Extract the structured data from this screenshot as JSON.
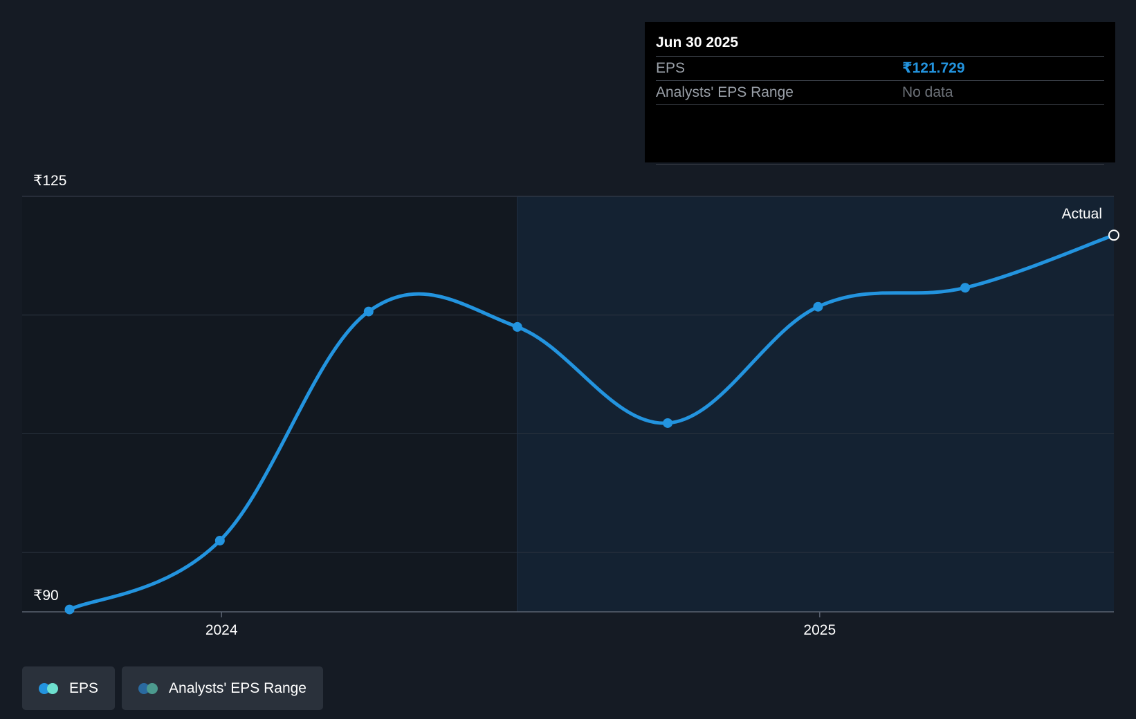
{
  "chart_data": {
    "type": "line",
    "x": [
      "2023-09-30",
      "2023-12-31",
      "2024-03-31",
      "2024-06-30",
      "2024-09-30",
      "2024-12-31",
      "2025-03-31",
      "2025-06-30"
    ],
    "series": [
      {
        "name": "EPS",
        "color": "#2394df",
        "values": [
          90.2,
          96.0,
          115.3,
          114.0,
          105.9,
          115.7,
          117.3,
          121.729
        ]
      }
    ],
    "ylim": [
      90,
      125
    ],
    "y_tick_labels": [
      "₹125",
      "₹90"
    ],
    "x_tick_labels": [
      "2024",
      "2025"
    ],
    "x_ticks": [
      "2024-01-01",
      "2025-01-01"
    ],
    "actual_region_label": "Actual",
    "actual_region_start": "2024-06-30",
    "grid": true,
    "legend_position": "bottom-left"
  },
  "tooltip": {
    "date": "Jun 30 2025",
    "eps_label": "EPS",
    "eps_value": "₹121.729",
    "range_label": "Analysts' EPS Range",
    "range_value": "No data"
  },
  "legend": {
    "eps_label": "EPS",
    "range_label": "Analysts' EPS Range",
    "eps_colors": [
      "#2394df",
      "#6ee0cf"
    ],
    "range_colors": [
      "#2a6aa0",
      "#4c9a8e"
    ]
  },
  "colors": {
    "background": "#151b24",
    "actual_region": "#142232",
    "past_region": "#121820",
    "gridline": "#2c3440",
    "axis": "#5a6270",
    "line": "#2394df"
  }
}
